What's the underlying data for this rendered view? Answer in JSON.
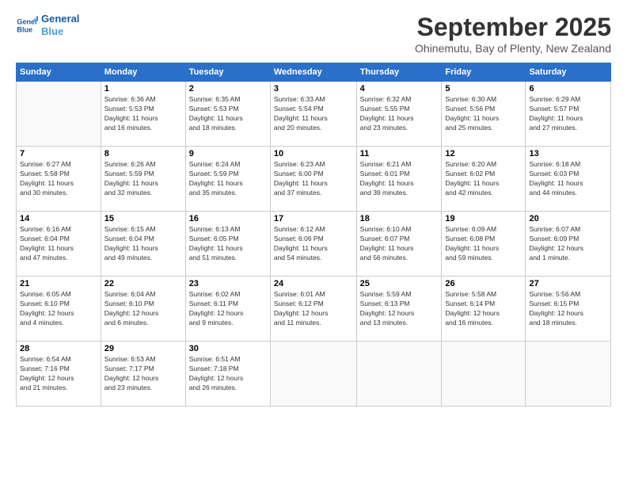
{
  "logo": {
    "line1": "General",
    "line2": "Blue"
  },
  "title": "September 2025",
  "location": "Ohinemutu, Bay of Plenty, New Zealand",
  "weekdays": [
    "Sunday",
    "Monday",
    "Tuesday",
    "Wednesday",
    "Thursday",
    "Friday",
    "Saturday"
  ],
  "weeks": [
    [
      {
        "day": "",
        "info": ""
      },
      {
        "day": "1",
        "info": "Sunrise: 6:36 AM\nSunset: 5:53 PM\nDaylight: 11 hours\nand 16 minutes."
      },
      {
        "day": "2",
        "info": "Sunrise: 6:35 AM\nSunset: 5:53 PM\nDaylight: 11 hours\nand 18 minutes."
      },
      {
        "day": "3",
        "info": "Sunrise: 6:33 AM\nSunset: 5:54 PM\nDaylight: 11 hours\nand 20 minutes."
      },
      {
        "day": "4",
        "info": "Sunrise: 6:32 AM\nSunset: 5:55 PM\nDaylight: 11 hours\nand 23 minutes."
      },
      {
        "day": "5",
        "info": "Sunrise: 6:30 AM\nSunset: 5:56 PM\nDaylight: 11 hours\nand 25 minutes."
      },
      {
        "day": "6",
        "info": "Sunrise: 6:29 AM\nSunset: 5:57 PM\nDaylight: 11 hours\nand 27 minutes."
      }
    ],
    [
      {
        "day": "7",
        "info": "Sunrise: 6:27 AM\nSunset: 5:58 PM\nDaylight: 11 hours\nand 30 minutes."
      },
      {
        "day": "8",
        "info": "Sunrise: 6:26 AM\nSunset: 5:59 PM\nDaylight: 11 hours\nand 32 minutes."
      },
      {
        "day": "9",
        "info": "Sunrise: 6:24 AM\nSunset: 5:59 PM\nDaylight: 11 hours\nand 35 minutes."
      },
      {
        "day": "10",
        "info": "Sunrise: 6:23 AM\nSunset: 6:00 PM\nDaylight: 11 hours\nand 37 minutes."
      },
      {
        "day": "11",
        "info": "Sunrise: 6:21 AM\nSunset: 6:01 PM\nDaylight: 11 hours\nand 39 minutes."
      },
      {
        "day": "12",
        "info": "Sunrise: 6:20 AM\nSunset: 6:02 PM\nDaylight: 11 hours\nand 42 minutes."
      },
      {
        "day": "13",
        "info": "Sunrise: 6:18 AM\nSunset: 6:03 PM\nDaylight: 11 hours\nand 44 minutes."
      }
    ],
    [
      {
        "day": "14",
        "info": "Sunrise: 6:16 AM\nSunset: 6:04 PM\nDaylight: 11 hours\nand 47 minutes."
      },
      {
        "day": "15",
        "info": "Sunrise: 6:15 AM\nSunset: 6:04 PM\nDaylight: 11 hours\nand 49 minutes."
      },
      {
        "day": "16",
        "info": "Sunrise: 6:13 AM\nSunset: 6:05 PM\nDaylight: 11 hours\nand 51 minutes."
      },
      {
        "day": "17",
        "info": "Sunrise: 6:12 AM\nSunset: 6:06 PM\nDaylight: 11 hours\nand 54 minutes."
      },
      {
        "day": "18",
        "info": "Sunrise: 6:10 AM\nSunset: 6:07 PM\nDaylight: 11 hours\nand 56 minutes."
      },
      {
        "day": "19",
        "info": "Sunrise: 6:09 AM\nSunset: 6:08 PM\nDaylight: 11 hours\nand 59 minutes."
      },
      {
        "day": "20",
        "info": "Sunrise: 6:07 AM\nSunset: 6:09 PM\nDaylight: 12 hours\nand 1 minute."
      }
    ],
    [
      {
        "day": "21",
        "info": "Sunrise: 6:05 AM\nSunset: 6:10 PM\nDaylight: 12 hours\nand 4 minutes."
      },
      {
        "day": "22",
        "info": "Sunrise: 6:04 AM\nSunset: 6:10 PM\nDaylight: 12 hours\nand 6 minutes."
      },
      {
        "day": "23",
        "info": "Sunrise: 6:02 AM\nSunset: 6:11 PM\nDaylight: 12 hours\nand 9 minutes."
      },
      {
        "day": "24",
        "info": "Sunrise: 6:01 AM\nSunset: 6:12 PM\nDaylight: 12 hours\nand 11 minutes."
      },
      {
        "day": "25",
        "info": "Sunrise: 5:59 AM\nSunset: 6:13 PM\nDaylight: 12 hours\nand 13 minutes."
      },
      {
        "day": "26",
        "info": "Sunrise: 5:58 AM\nSunset: 6:14 PM\nDaylight: 12 hours\nand 16 minutes."
      },
      {
        "day": "27",
        "info": "Sunrise: 5:56 AM\nSunset: 6:15 PM\nDaylight: 12 hours\nand 18 minutes."
      }
    ],
    [
      {
        "day": "28",
        "info": "Sunrise: 6:54 AM\nSunset: 7:16 PM\nDaylight: 12 hours\nand 21 minutes."
      },
      {
        "day": "29",
        "info": "Sunrise: 6:53 AM\nSunset: 7:17 PM\nDaylight: 12 hours\nand 23 minutes."
      },
      {
        "day": "30",
        "info": "Sunrise: 6:51 AM\nSunset: 7:18 PM\nDaylight: 12 hours\nand 26 minutes."
      },
      {
        "day": "",
        "info": ""
      },
      {
        "day": "",
        "info": ""
      },
      {
        "day": "",
        "info": ""
      },
      {
        "day": "",
        "info": ""
      }
    ]
  ]
}
